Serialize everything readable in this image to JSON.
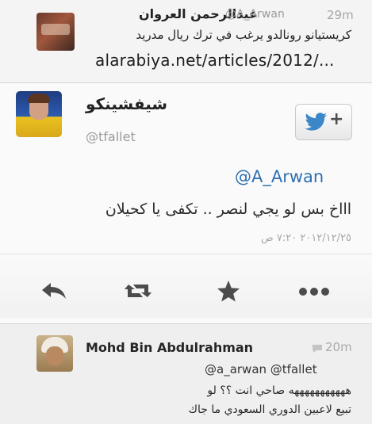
{
  "top_tweet": {
    "name": "عبدالرحمن العروان",
    "handle": "@A_Arwan",
    "time": "29m",
    "text": "كريستيانو رونالدو يرغب في ترك ريال مدريد",
    "link": "alarabiya.net/articles/2012/..."
  },
  "main_tweet": {
    "name": "شيفشينكو",
    "handle": "@tfallet",
    "follow_label": "+",
    "mention": "@A_Arwan",
    "text": "اااخ بس لو يجي لنصر .. تكفى يا كحيلان",
    "date": "٢٠١٢/١٢/٢٥ ٧:٢٠ ص",
    "actions": [
      "reply-icon",
      "retweet-icon",
      "favorite-icon",
      "more-icon"
    ]
  },
  "reply_tweet": {
    "name": "Mohd Bin Abdulrahman",
    "time": "20m",
    "mentions": "@a_arwan @tfallet",
    "line1": "هههههههههههه صاحي انت ؟؟ لو",
    "line2": "تبيع لاعبين الدوري السعودي ما جاك"
  },
  "colors": {
    "link_blue": "#2f6fb0",
    "twitter_bird": "#3b87c8",
    "icon_gray": "#4c4c4c"
  }
}
